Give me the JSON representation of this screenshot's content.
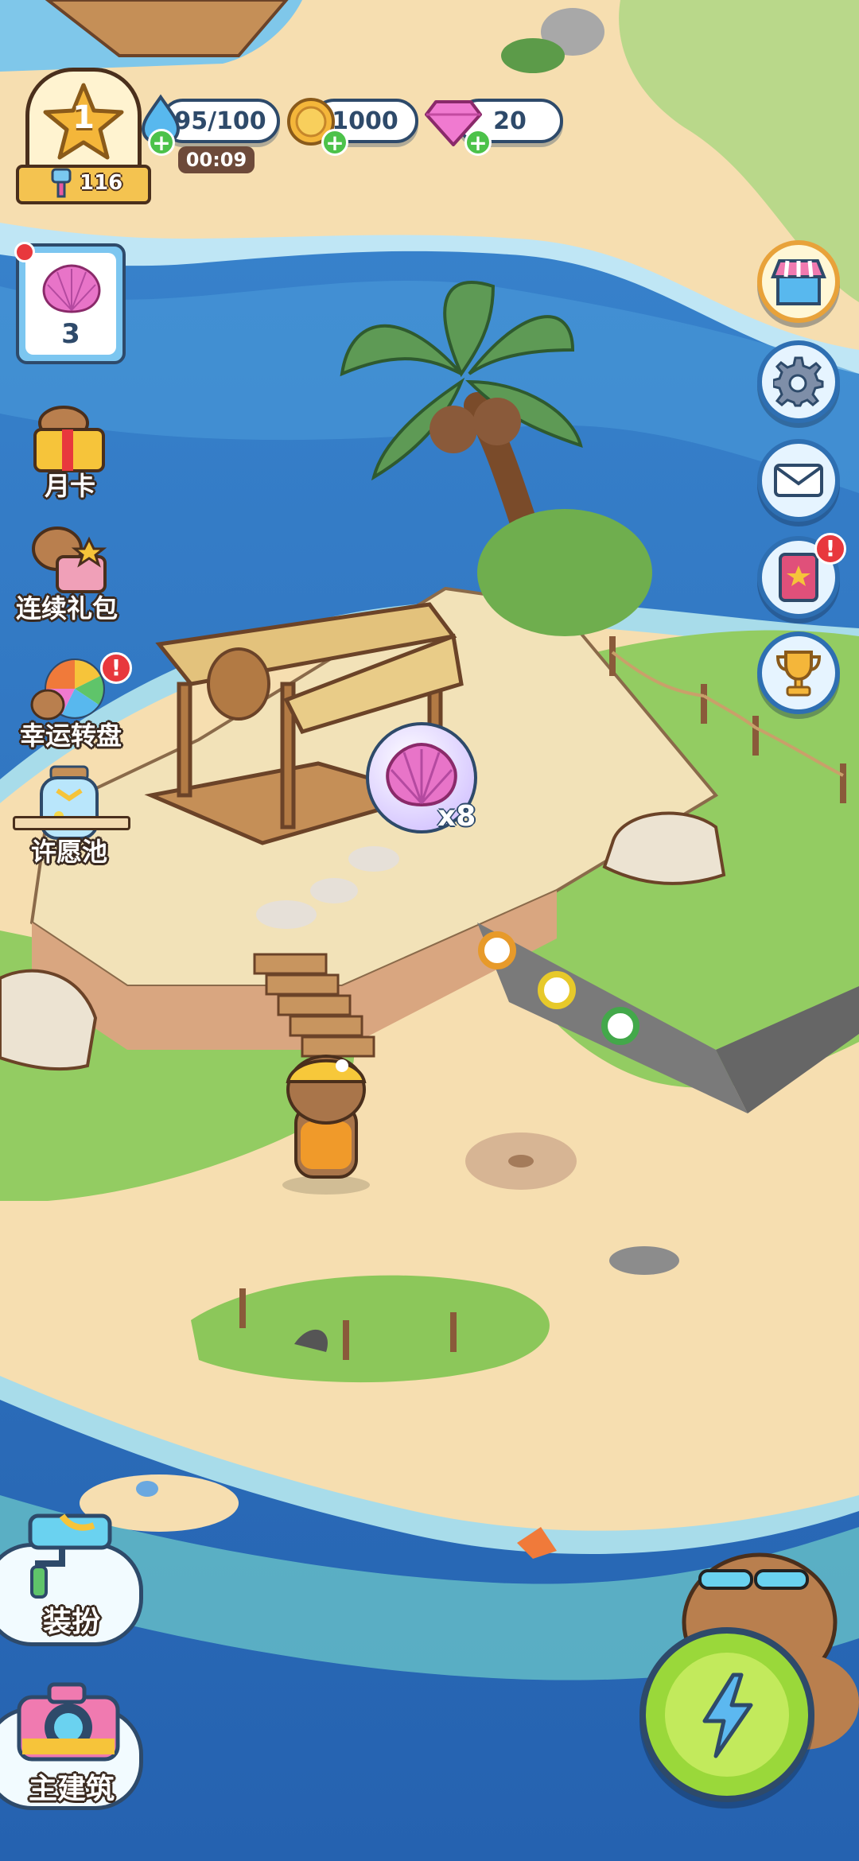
{
  "hud": {
    "level": "1",
    "level_points": "116",
    "energy": "95/100",
    "energy_timer": "00:09",
    "coins": "1000",
    "gems": "20",
    "plus_symbol": "+"
  },
  "shell_card": {
    "count": "3"
  },
  "side_menu": {
    "monthly_card": "月卡",
    "continuous_gift": "连续礼包",
    "lucky_wheel": "幸运转盘",
    "wishing_pool": "许愿池"
  },
  "shell_pickup": {
    "quantity": "x8"
  },
  "bottom_left": {
    "decorate": "装扮",
    "main_building": "主建筑"
  },
  "right_menu": {
    "alert_symbol": "!"
  },
  "icons": [
    "star-icon",
    "paint-brush-icon",
    "energy-drop-icon",
    "coin-icon",
    "gem-icon",
    "shell-icon",
    "shop-icon",
    "gear-icon",
    "mail-icon",
    "quest-book-icon",
    "trophy-icon",
    "paint-roller-icon",
    "camera-icon",
    "lightning-icon"
  ],
  "colors": {
    "sea_deep": "#2f78c4",
    "sea_light": "#5fb3e8",
    "sand": "#f6deb0",
    "grass": "#93cc62",
    "action_green": "#9ad83a",
    "badge_red": "#e8383d",
    "hud_navy": "#2e4a6a",
    "gold": "#f4b63a",
    "pink_shell": "#e874c8"
  }
}
